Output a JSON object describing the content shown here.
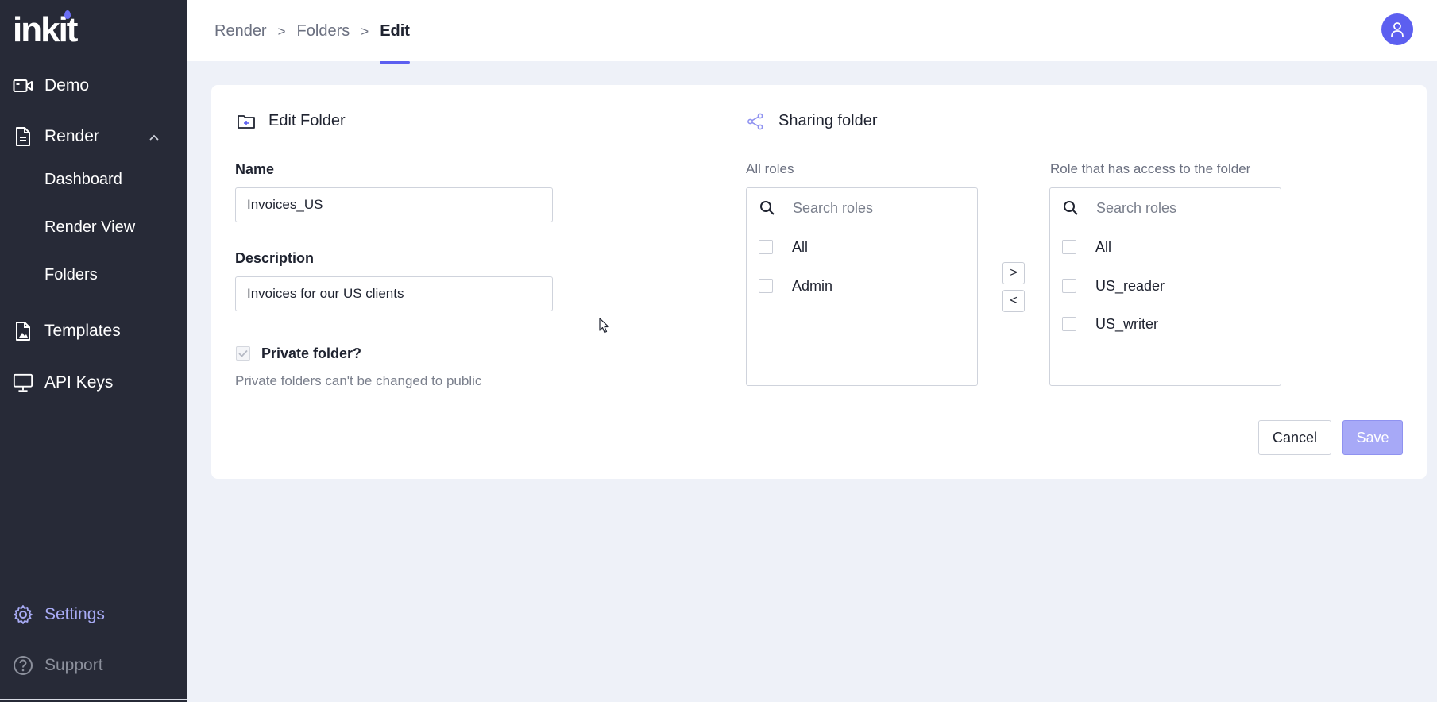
{
  "app": {
    "logo_text": "inkit",
    "brand_color": "#5c5ff0"
  },
  "sidebar": {
    "demo": "Demo",
    "render": "Render",
    "render_children": [
      "Dashboard",
      "Render View",
      "Folders"
    ],
    "templates": "Templates",
    "api_keys": "API Keys",
    "settings": "Settings",
    "support": "Support"
  },
  "breadcrumb": {
    "items": [
      "Render",
      "Folders",
      "Edit"
    ],
    "separator": ">"
  },
  "edit_folder": {
    "title": "Edit Folder",
    "name_label": "Name",
    "name_value": "Invoices_US",
    "description_label": "Description",
    "description_value": "Invoices for our US clients",
    "private_label": "Private folder?",
    "private_checked": true,
    "private_hint": "Private folders can't be changed to public"
  },
  "sharing": {
    "title": "Sharing folder",
    "all_roles_label": "All roles",
    "access_roles_label": "Role that has access to the folder",
    "search_placeholder": "Search roles",
    "all_roles": [
      "All",
      "Admin"
    ],
    "access_roles": [
      "All",
      "US_reader",
      "US_writer"
    ],
    "move_right": ">",
    "move_left": "<"
  },
  "actions": {
    "cancel": "Cancel",
    "save": "Save"
  }
}
